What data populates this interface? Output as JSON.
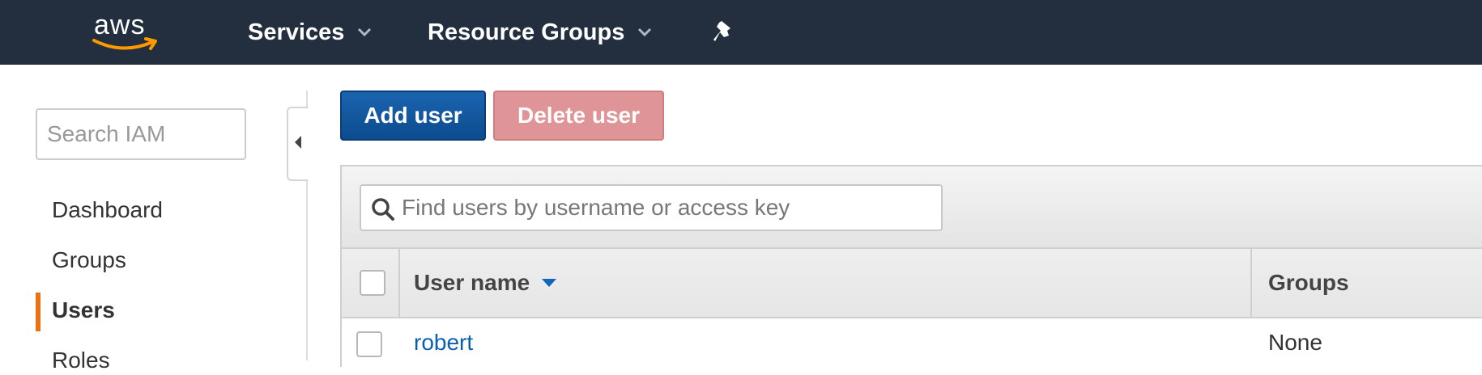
{
  "brand": {
    "logo_text": "aws"
  },
  "topnav": {
    "services_label": "Services",
    "resource_groups_label": "Resource Groups",
    "icons": [
      "chevron-down-icon",
      "pin-icon"
    ]
  },
  "sidebar": {
    "search_placeholder": "Search IAM",
    "items": [
      {
        "label": "Dashboard",
        "active": false
      },
      {
        "label": "Groups",
        "active": false
      },
      {
        "label": "Users",
        "active": true
      },
      {
        "label": "Roles",
        "active": false
      }
    ]
  },
  "toolbar": {
    "add_user_label": "Add user",
    "delete_user_label": "Delete user"
  },
  "filter": {
    "placeholder": "Find users by username or access key"
  },
  "table": {
    "columns": [
      "User name",
      "Groups"
    ],
    "sort_column": "User name",
    "sort_direction": "descending",
    "rows": [
      {
        "user_name": "robert",
        "groups": "None"
      }
    ]
  },
  "colors": {
    "nav_bg": "#232f3e",
    "accent_orange": "#ec7211",
    "primary_blue": "#0d4b8e",
    "link_blue": "#0b5fb2",
    "danger_disabled": "#df9497"
  }
}
